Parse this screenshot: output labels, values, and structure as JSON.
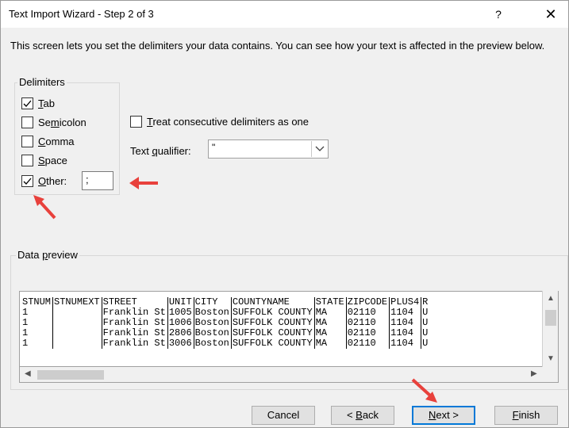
{
  "window": {
    "title": "Text Import Wizard - Step 2 of 3",
    "help_glyph": "?",
    "close_glyph": "✕"
  },
  "intro_text": "This screen lets you set the delimiters your data contains.  You can see how your text is affected in the preview below.",
  "delimiters": {
    "group_label": "Delimiters",
    "tab": {
      "label": "Tab",
      "checked": true
    },
    "semicolon": {
      "label": "Semicolon",
      "checked": false
    },
    "comma": {
      "label": "Comma",
      "checked": false
    },
    "space": {
      "label": "Space",
      "checked": false
    },
    "other": {
      "label": "Other:",
      "checked": true,
      "value": ";"
    }
  },
  "treat_consecutive": {
    "label": "Treat consecutive delimiters as one",
    "checked": false
  },
  "text_qualifier": {
    "label": "Text qualifier:",
    "value": "\""
  },
  "data_preview": {
    "group_label": "Data preview",
    "rows": [
      [
        "STNUM",
        "STNUMEXT",
        "STREET",
        "UNIT",
        "CITY",
        "COUNTYNAME",
        "STATE",
        "ZIPCODE",
        "PLUS4",
        "R"
      ],
      [
        "1",
        "",
        "Franklin St",
        "1005",
        "Boston",
        "SUFFOLK COUNTY",
        "MA",
        "02110",
        "1104",
        "U"
      ],
      [
        "1",
        "",
        "Franklin St",
        "1006",
        "Boston",
        "SUFFOLK COUNTY",
        "MA",
        "02110",
        "1104",
        "U"
      ],
      [
        "1",
        "",
        "Franklin St",
        "2806",
        "Boston",
        "SUFFOLK COUNTY",
        "MA",
        "02110",
        "1104",
        "U"
      ],
      [
        "1",
        "",
        "Franklin St",
        "3006",
        "Boston",
        "SUFFOLK COUNTY",
        "MA",
        "02110",
        "1104",
        "U"
      ]
    ]
  },
  "buttons": {
    "cancel": "Cancel",
    "back": "< Back",
    "next": "Next >",
    "finish": "Finish"
  },
  "colors": {
    "annotation_arrow": "#e8413c",
    "default_button_border": "#0078d7"
  }
}
